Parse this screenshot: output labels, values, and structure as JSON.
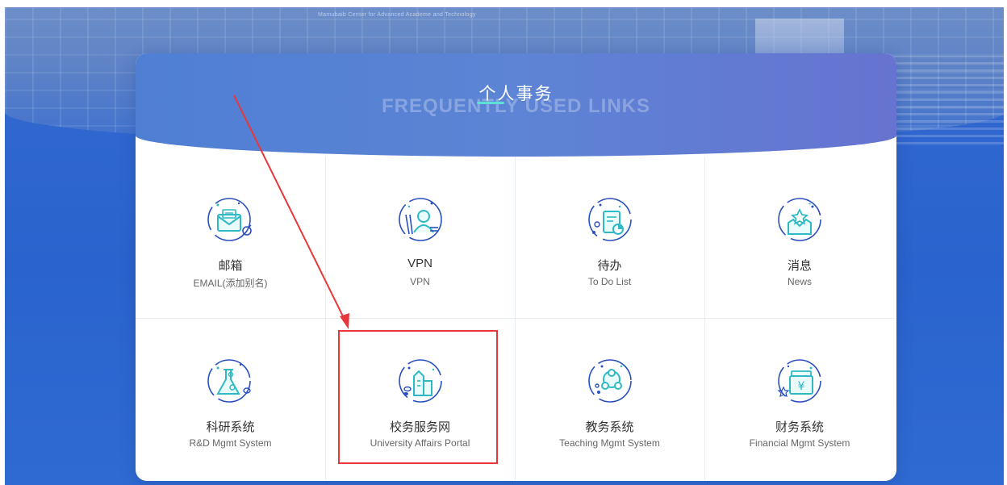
{
  "background": {
    "caption": "Mamubaib Center for Advanced Academe and Technology"
  },
  "panel": {
    "title": "个人事务",
    "subtitle_bg": "FREQUENTLY USED LINKS"
  },
  "tiles": [
    {
      "cn": "邮箱",
      "en": "EMAIL(添加别名)",
      "icon": "mail-icon"
    },
    {
      "cn": "VPN",
      "en": "VPN",
      "icon": "vpn-user-icon"
    },
    {
      "cn": "待办",
      "en": "To Do List",
      "icon": "todo-icon"
    },
    {
      "cn": "消息",
      "en": "News",
      "icon": "news-icon"
    },
    {
      "cn": "科研系统",
      "en": "R&D Mgmt System",
      "icon": "flask-icon"
    },
    {
      "cn": "校务服务网",
      "en": "University Affairs Portal",
      "icon": "building-icon"
    },
    {
      "cn": "教务系统",
      "en": "Teaching Mgmt System",
      "icon": "network-icon"
    },
    {
      "cn": "财务系统",
      "en": "Financial Mgmt System",
      "icon": "yuan-money-icon"
    }
  ],
  "colors": {
    "accent_teal": "#2fb9c4",
    "accent_blue": "#2a4fbf",
    "annotation_red": "#e8373a"
  }
}
